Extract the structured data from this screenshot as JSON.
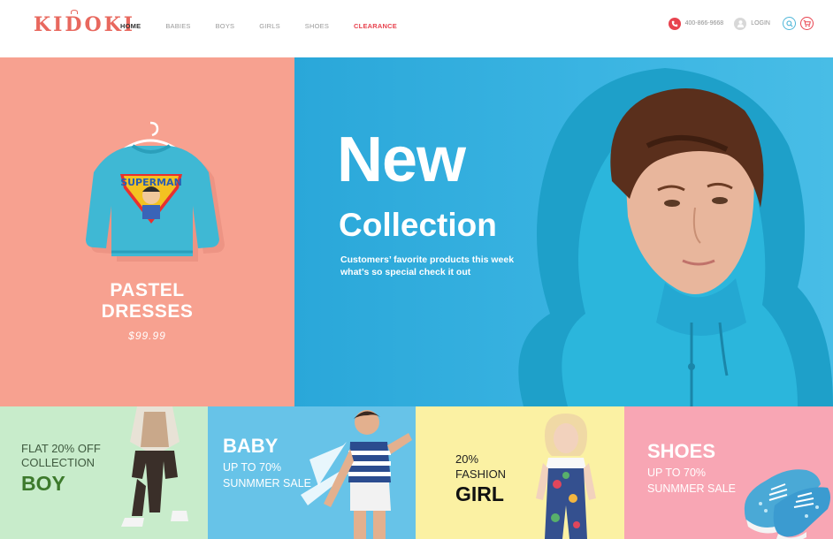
{
  "brand": {
    "logo_text": "KIDOKI",
    "accent_color": "#e8434f"
  },
  "nav": {
    "items": [
      {
        "label": "HOME",
        "state": "active"
      },
      {
        "label": "BABIES"
      },
      {
        "label": "BOYS"
      },
      {
        "label": "GIRLS"
      },
      {
        "label": "SHOES"
      },
      {
        "label": "CLEARANCE",
        "state": "highlight"
      }
    ]
  },
  "header_right": {
    "phone": "400-866-9668",
    "phone_icon": "phone-icon",
    "login_label": "LOGIN",
    "user_icon": "user-icon",
    "search_icon": "search-icon",
    "cart_icon": "cart-icon"
  },
  "hero_left": {
    "title_line1": "PASTEL",
    "title_line2": "DRESSES",
    "price": "$99.99",
    "bg_color": "#f7a190"
  },
  "hero_right": {
    "headline": "New",
    "headline2": "Collection",
    "sub_line1": "Customers’ favorite products this week",
    "sub_line2": "what’s so special check it out",
    "bg_color": "#2aa7d9"
  },
  "tiles": [
    {
      "line1": "FLAT 20% OFF",
      "line2": "COLLECTION",
      "line3": "BOY",
      "bg_color": "#c8eccb"
    },
    {
      "line1": "BABY",
      "line2": "UP TO 70%",
      "line3": "SUNMMER SALE",
      "bg_color": "#67c3e8"
    },
    {
      "line1": "20%",
      "line2": "FASHION",
      "line3": "GIRL",
      "bg_color": "#fbf1a3"
    },
    {
      "line1": "SHOES",
      "line2": "UP TO 70%",
      "line3": "SUNMMER SALE",
      "bg_color": "#f8a6b4"
    }
  ]
}
